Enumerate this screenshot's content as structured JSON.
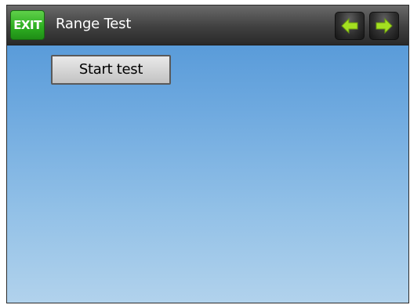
{
  "header": {
    "exit_label": "EXIT",
    "title": "Range Test",
    "prev_icon": "arrow-left-icon",
    "next_icon": "arrow-right-icon"
  },
  "main": {
    "start_button_label": "Start test"
  },
  "colors": {
    "exit_green": "#2fb022",
    "arrow_green": "#a4e021",
    "background_top": "#4d93d6",
    "background_bottom": "#b1d2ec"
  }
}
